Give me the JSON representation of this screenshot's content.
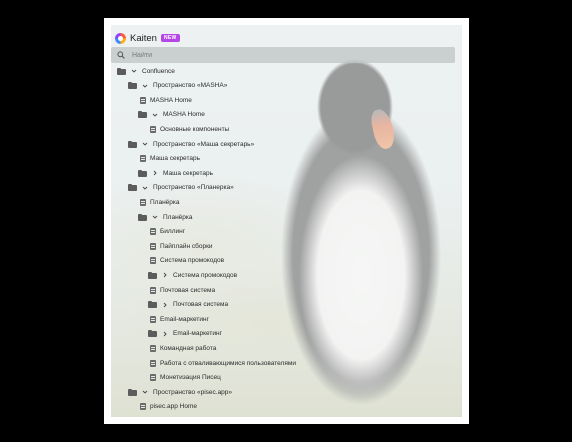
{
  "app": {
    "title": "Kaiten",
    "badge": "NEW"
  },
  "search": {
    "placeholder": "Найти"
  },
  "tree": [
    {
      "type": "folder",
      "expanded": true,
      "label": "Confluence"
    },
    {
      "type": "folder",
      "expanded": true,
      "label": "Пространство «MASHA»"
    },
    {
      "type": "page",
      "label": "MASHA Home"
    },
    {
      "type": "folder",
      "expanded": true,
      "label": "MASHA Home"
    },
    {
      "type": "page",
      "label": "Основные компоненты"
    },
    {
      "type": "folder",
      "expanded": true,
      "label": "Пространство «Маша секретарь»"
    },
    {
      "type": "page",
      "label": "Маша секретарь"
    },
    {
      "type": "folder",
      "expanded": false,
      "label": "Маша секретарь"
    },
    {
      "type": "folder",
      "expanded": true,
      "label": "Пространство «Планерка»"
    },
    {
      "type": "page",
      "label": "Планёрка"
    },
    {
      "type": "folder",
      "expanded": true,
      "label": "Планёрка"
    },
    {
      "type": "page",
      "label": "Биллинг"
    },
    {
      "type": "page",
      "label": "Пайплайн сборки"
    },
    {
      "type": "page",
      "label": "Система промокодов"
    },
    {
      "type": "folder",
      "expanded": false,
      "label": "Система промокодов"
    },
    {
      "type": "page",
      "label": "Почтовая система"
    },
    {
      "type": "folder",
      "expanded": false,
      "label": "Почтовая система"
    },
    {
      "type": "page",
      "label": "Email-маркетинг"
    },
    {
      "type": "folder",
      "expanded": false,
      "label": "Email-маркетинг"
    },
    {
      "type": "page",
      "label": "Командная работа"
    },
    {
      "type": "page",
      "label": "Работа с отваливающимися пользователями"
    },
    {
      "type": "page",
      "label": "Монетизация Писец"
    },
    {
      "type": "folder",
      "expanded": true,
      "label": "Пространство «pisec.app»"
    },
    {
      "type": "page",
      "label": "pisec.app Home"
    }
  ]
}
